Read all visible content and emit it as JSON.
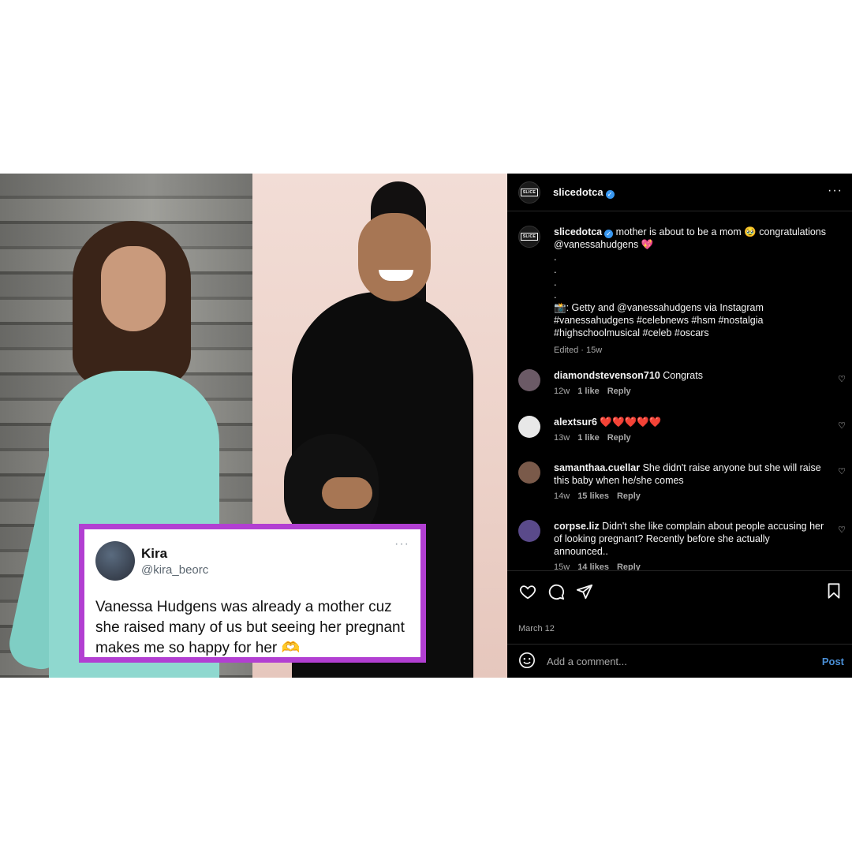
{
  "tweet": {
    "name": "Kira",
    "handle": "@kira_beorc",
    "more": "···",
    "text": "Vanessa Hudgens was already a mother cuz she raised many of us but seeing her pregnant makes me so happy for her 🫶"
  },
  "header": {
    "logo_text": "SLICE",
    "username": "slicedotca",
    "more": "···"
  },
  "caption": {
    "username": "slicedotca",
    "text_line1": " mother is about to be a mom 🥹 congratulations",
    "text_line2": "@vanessahudgens 💖",
    "dots": [
      ".",
      ".",
      ".",
      "."
    ],
    "credit": "📸: Getty and @vanessahudgens via Instagram",
    "tags_line1": "#vanessahudgens #celebnews #hsm #nostalgia",
    "tags_line2": "#highschoolmusical #celeb #oscars",
    "meta": "Edited · 15w"
  },
  "comments": [
    {
      "username": "diamondstevenson710",
      "text": " Congrats",
      "age": "12w",
      "likes": "1 like",
      "reply": "Reply",
      "avatar_color": "#6b5a66"
    },
    {
      "username": "alextsur6",
      "text": " ❤️❤️❤️❤️❤️",
      "age": "13w",
      "likes": "1 like",
      "reply": "Reply",
      "avatar_color": "#e8e8e8"
    },
    {
      "username": "samanthaa.cuellar",
      "text": " She didn't raise anyone but she will raise this baby when he/she comes",
      "age": "14w",
      "likes": "15 likes",
      "reply": "Reply",
      "avatar_color": "#7a5a4a"
    },
    {
      "username": "corpse.liz",
      "text": " Didn't she like complain about people accusing her of looking pregnant? Recently before she actually announced..",
      "age": "15w",
      "likes": "14 likes",
      "reply": "Reply",
      "avatar_color": "#5a4a8a"
    }
  ],
  "actions": {
    "date": "March 12",
    "comment_placeholder": "Add a comment...",
    "post_label": "Post"
  },
  "colors": {
    "tweet_border": "#b23fd2",
    "verified": "#3897f0",
    "post_link": "#4a8fd6"
  }
}
